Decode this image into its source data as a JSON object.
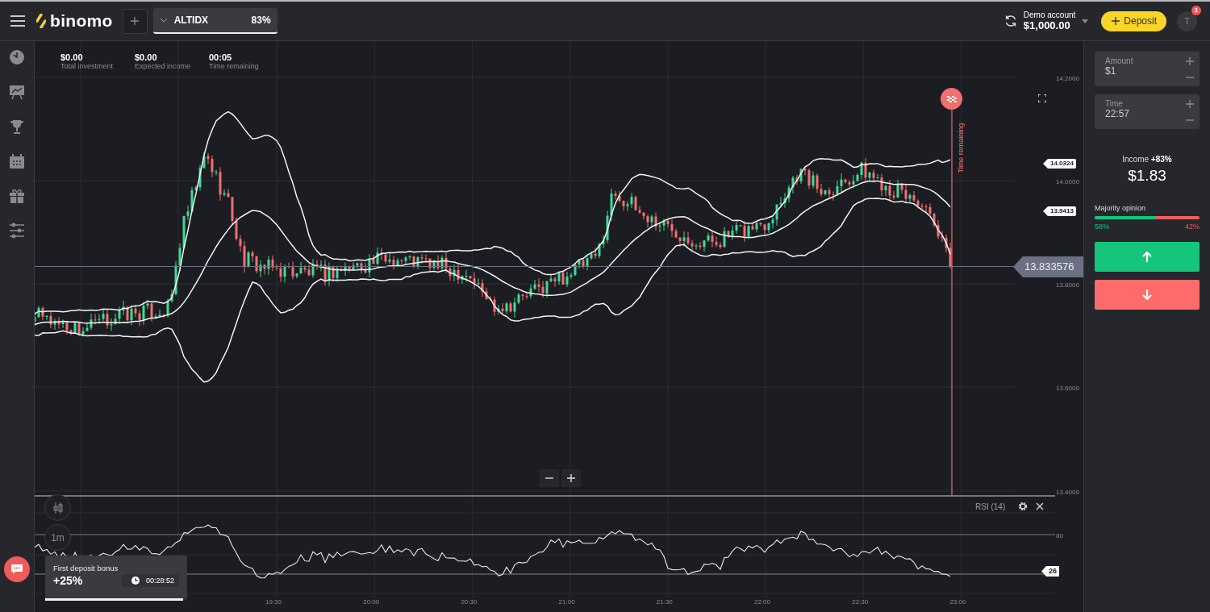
{
  "header": {
    "logo": "binomo",
    "asset": {
      "name": "ALTIDX",
      "payout": "83%"
    },
    "account": {
      "label": "Demo account",
      "balance": "$1,000.00"
    },
    "deposit_button": "Deposit",
    "avatar": {
      "initial": "T",
      "badge": "1"
    }
  },
  "stats": [
    {
      "value": "$0.00",
      "label": "Total investment"
    },
    {
      "value": "$0.00",
      "label": "Expected income"
    },
    {
      "value": "00:05",
      "label": "Time remaining"
    }
  ],
  "chart": {
    "y_ticks": [
      "14.2000",
      "14.0000",
      "13.8000",
      "13.6000",
      "13.4000"
    ],
    "x_ticks": [
      "19:30",
      "20:00",
      "20:30",
      "21:00",
      "21:30",
      "22:00",
      "22:30",
      "23:00"
    ],
    "price_tags": [
      "14.0324",
      "13.9413"
    ],
    "current_price": "13.833576",
    "expiry_label": "Time remaining"
  },
  "indicator": {
    "name": "RSI (14)",
    "level_label": "80",
    "value_tag": "26"
  },
  "interval_button": "1m",
  "bonus": {
    "title": "First deposit bonus",
    "value": "+25%",
    "timer": "00:28:52",
    "level": 0.97
  },
  "trade_panel": {
    "amount": {
      "label": "Amount",
      "value": "$1"
    },
    "time": {
      "label": "Time",
      "value": "22:57"
    },
    "income_text": "Income **+83%**",
    "income_value": "$1.83",
    "majority": {
      "title": "Majority opinion",
      "up": "58%",
      "down": "42%",
      "level": 0.58
    }
  }
}
